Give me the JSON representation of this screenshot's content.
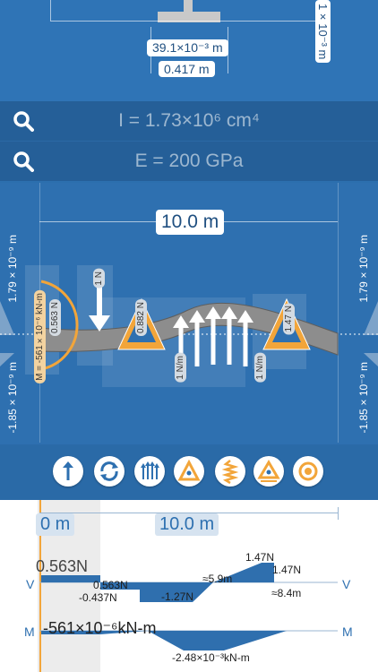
{
  "section": {
    "width_label": "39.1×10⁻³ m",
    "height_label": "0.417 m",
    "side_label": "1×10⁻³ m"
  },
  "properties": {
    "inertia": "I = 1.73×10⁶ cm⁴",
    "modulus": "E = 200 GPa"
  },
  "beam": {
    "length_label": "10.0 m",
    "deflection_top": "1.79×10⁻⁹ m",
    "deflection_bottom": "-1.85×10⁻⁹ m",
    "labels": {
      "moment": "M = -561×10⁻⁶ kN-m",
      "reaction_left": "0.563 N",
      "point_load": "1 N",
      "support_a": "0.882 N",
      "dist_load_a": "1 N/m",
      "dist_load_b": "1 N/m",
      "support_b": "1.47 N"
    }
  },
  "tools": [
    {
      "name": "point-load-tool",
      "icon": "arrow-up-icon"
    },
    {
      "name": "moment-tool",
      "icon": "rotate-icon"
    },
    {
      "name": "distributed-load-tool",
      "icon": "distributed-arrows-icon"
    },
    {
      "name": "pin-support-tool",
      "icon": "triangle-support-icon"
    },
    {
      "name": "spring-tool",
      "icon": "spring-icon"
    },
    {
      "name": "roller-support-tool",
      "icon": "roller-triangle-icon"
    },
    {
      "name": "fixed-tool",
      "icon": "target-icon"
    }
  ],
  "diagram": {
    "start_label": "0 m",
    "end_label": "10.0 m",
    "v_axis": "V",
    "m_axis": "M",
    "shear": {
      "max_left": "0.563N",
      "v1": "0.563N",
      "v2": "-0.437N",
      "v3": "-1.27N",
      "zero1": "≈5.9m",
      "top": "1.47N",
      "v4": "1.47N",
      "zero2": "≈8.4m"
    },
    "moment": {
      "left": "-561×10⁻⁶kN-m",
      "min": "-2.48×10⁻³kN-m"
    }
  },
  "colors": {
    "accent": "#f2a53a",
    "blue": "#2e70b0",
    "diagram_fill": "#2f6fae"
  }
}
